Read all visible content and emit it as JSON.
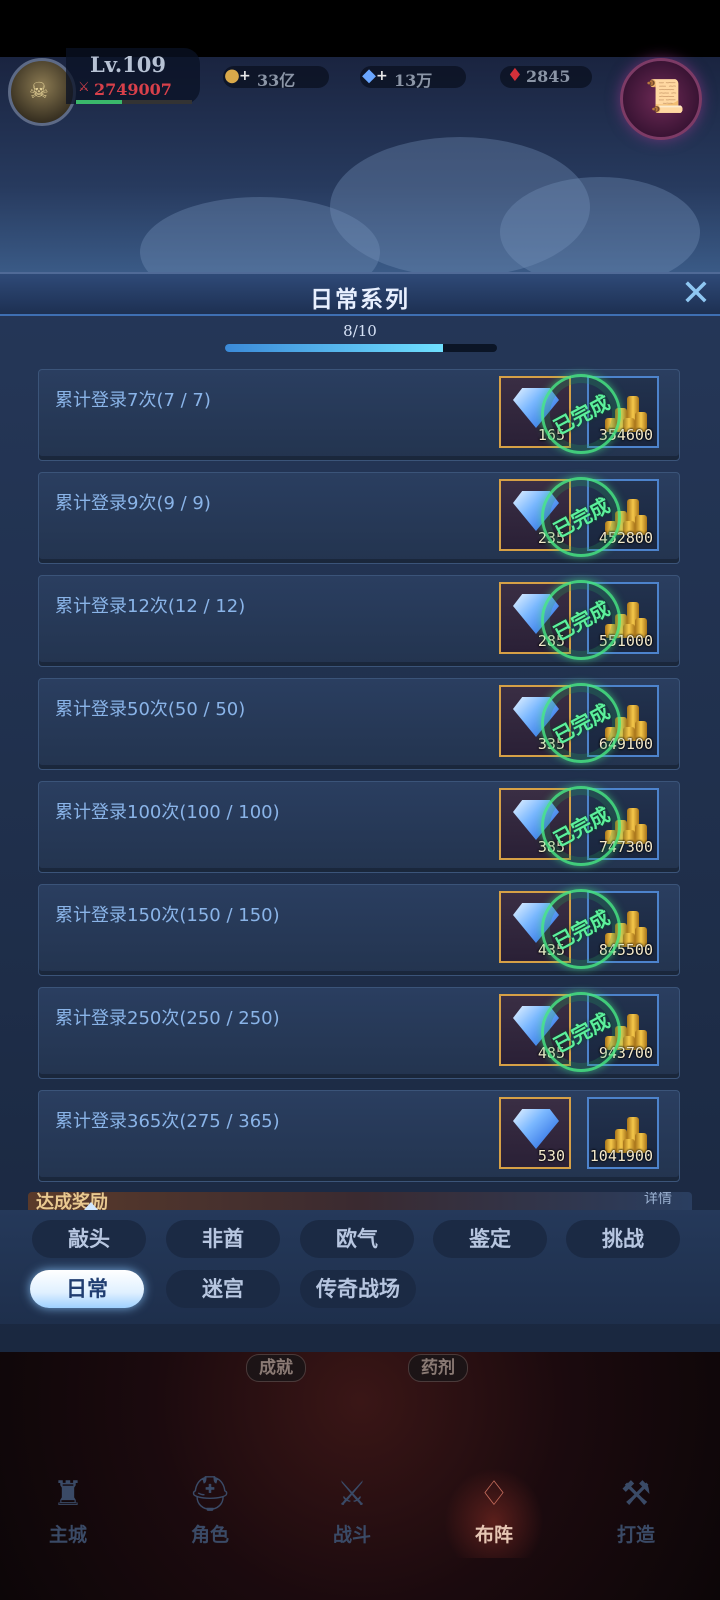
{
  "player": {
    "level": "Lv.109",
    "power": "2749007",
    "power_fraction": 0.4
  },
  "currencies": [
    {
      "icon": "gold-coin-icon",
      "value": "33亿"
    },
    {
      "icon": "diamond-icon",
      "value": "13万"
    },
    {
      "icon": "ruby-icon",
      "value": "2845"
    }
  ],
  "panel": {
    "title": "日常系列",
    "close_glyph": "✕",
    "progress_text": "8/10",
    "progress_fraction": 0.8
  },
  "achievements": [
    {
      "label": "累计登录7次(7 / 7)",
      "gem": "165",
      "gold": "354600",
      "completed": true
    },
    {
      "label": "累计登录9次(9 / 9)",
      "gem": "235",
      "gold": "452800",
      "completed": true
    },
    {
      "label": "累计登录12次(12 / 12)",
      "gem": "285",
      "gold": "551000",
      "completed": true
    },
    {
      "label": "累计登录50次(50 / 50)",
      "gem": "335",
      "gold": "649100",
      "completed": true
    },
    {
      "label": "累计登录100次(100 / 100)",
      "gem": "385",
      "gold": "747300",
      "completed": true
    },
    {
      "label": "累计登录150次(150 / 150)",
      "gem": "435",
      "gold": "845500",
      "completed": true
    },
    {
      "label": "累计登录250次(250 / 250)",
      "gem": "485",
      "gold": "943700",
      "completed": true
    },
    {
      "label": "累计登录365次(275 / 365)",
      "gem": "530",
      "gold": "1041900",
      "completed": false
    }
  ],
  "completed_stamp": "已完成",
  "reach_reward": {
    "title": "达成奖励",
    "detail": "详情"
  },
  "tabs": [
    {
      "label": "敲头",
      "active": false
    },
    {
      "label": "非酋",
      "active": false
    },
    {
      "label": "欧气",
      "active": false
    },
    {
      "label": "鉴定",
      "active": false
    },
    {
      "label": "挑战",
      "active": false
    },
    {
      "label": "日常",
      "active": true
    },
    {
      "label": "迷宫",
      "active": false
    },
    {
      "label": "传奇战场",
      "active": false
    }
  ],
  "lower_chips": [
    "成就",
    "药剂"
  ],
  "bottom_nav": [
    {
      "label": "主城",
      "icon": "castle-icon",
      "active": false
    },
    {
      "label": "角色",
      "icon": "helmet-icon",
      "active": false
    },
    {
      "label": "战斗",
      "icon": "crossed-swords-icon",
      "active": false
    },
    {
      "label": "布阵",
      "icon": "formation-icon",
      "active": true
    },
    {
      "label": "打造",
      "icon": "anvil-icon",
      "active": false
    }
  ]
}
